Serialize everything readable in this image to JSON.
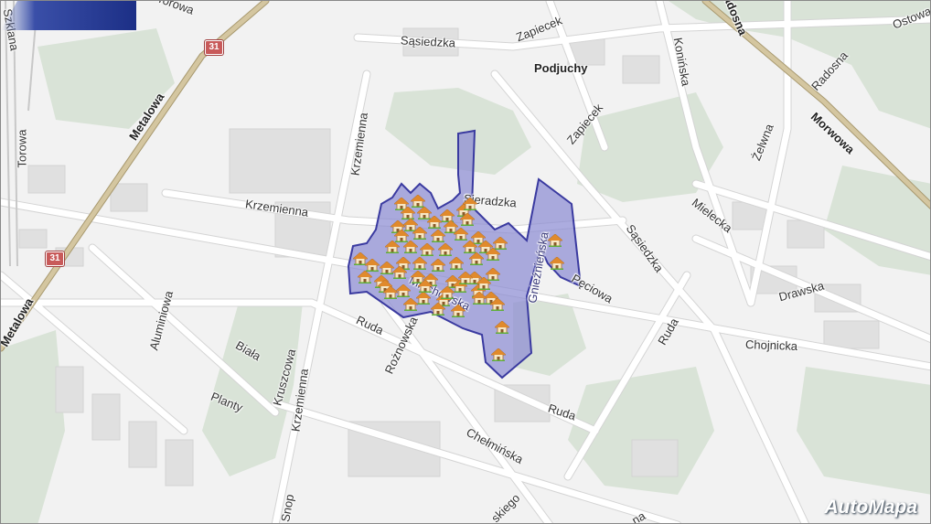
{
  "map": {
    "colors": {
      "background": "#f2f2f2",
      "green": "#d8e3d6",
      "building": "#e2e2e2",
      "road": "#ffffff",
      "road_outline": "#d4d4d4",
      "major_road": "#c7b895",
      "district_fill": "#8c8cd2",
      "district_stroke": "#3a3aa0"
    },
    "district_name": "Miechowska",
    "place_label": "Podjuchy",
    "streets": [
      {
        "id": "torowa-top",
        "text": "Torowa"
      },
      {
        "id": "szklana",
        "text": "Szklana"
      },
      {
        "id": "torowa",
        "text": "Torowa"
      },
      {
        "id": "metalowa",
        "text": "Metalowa"
      },
      {
        "id": "metalowa-2",
        "text": "Metalowa"
      },
      {
        "id": "sasiedzka-top",
        "text": "Sąsiedzka"
      },
      {
        "id": "zapiecek-1",
        "text": "Zapiecek"
      },
      {
        "id": "zapiecek-2",
        "text": "Zapiecek"
      },
      {
        "id": "koninska",
        "text": "Konińska"
      },
      {
        "id": "radosna-top",
        "text": "Radosna"
      },
      {
        "id": "radosna",
        "text": "Radosna"
      },
      {
        "id": "ostowa",
        "text": "Ostowa"
      },
      {
        "id": "morwowa",
        "text": "Morwowa"
      },
      {
        "id": "krzemienna-v",
        "text": "Krzemienna"
      },
      {
        "id": "krzemienna-h",
        "text": "Krzemienna"
      },
      {
        "id": "sieradzka",
        "text": "Sieradzka"
      },
      {
        "id": "zelwna",
        "text": "Żelwna"
      },
      {
        "id": "mielecka",
        "text": "Mielecka"
      },
      {
        "id": "sasiedzka",
        "text": "Sąsiedzka"
      },
      {
        "id": "drawska",
        "text": "Drawska"
      },
      {
        "id": "chojnicka",
        "text": "Chojnicka"
      },
      {
        "id": "pieciowa",
        "text": "Pęciowa"
      },
      {
        "id": "ruda-right",
        "text": "Ruda"
      },
      {
        "id": "ruda-mid",
        "text": "Ruda"
      },
      {
        "id": "ruda-bottom",
        "text": "Ruda"
      },
      {
        "id": "rozanowska",
        "text": "Rożnowska"
      },
      {
        "id": "miechowska",
        "text": "Miechowska"
      },
      {
        "id": "gnieznienska",
        "text": "Gnieźnieńska"
      },
      {
        "id": "aluminiowa",
        "text": "Aluminiowa"
      },
      {
        "id": "biala",
        "text": "Biała"
      },
      {
        "id": "kruszcowa",
        "text": "Kruszcowa"
      },
      {
        "id": "planty",
        "text": "Planty"
      },
      {
        "id": "krzemienna-low",
        "text": "Krzemienna"
      },
      {
        "id": "chelminska",
        "text": "Chełmińska"
      },
      {
        "id": "snop",
        "text": "Snop"
      },
      {
        "id": "kiego",
        "text": "skiego"
      },
      {
        "id": "na",
        "text": "na"
      }
    ],
    "road_shields": [
      "31",
      "31"
    ],
    "house_icon": "house-icon",
    "house_count": 62,
    "logo": "AutoMapa"
  }
}
